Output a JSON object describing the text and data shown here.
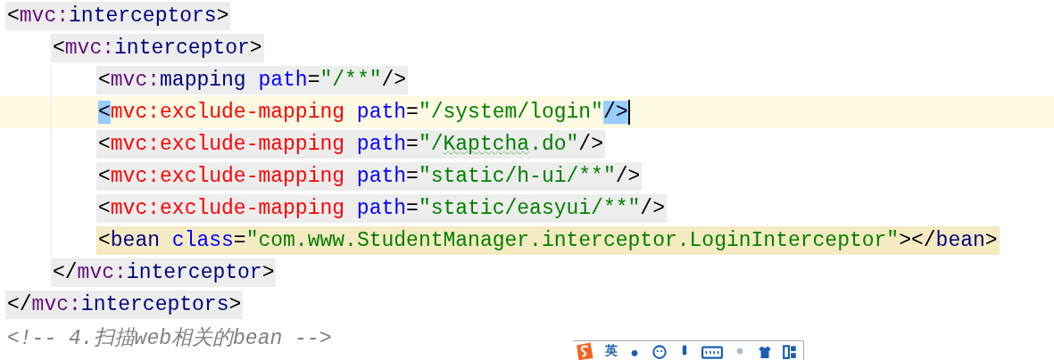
{
  "lines": [
    {
      "kind": "shaded",
      "tokens": [
        {
          "kind": "punct",
          "text": "<"
        },
        {
          "kind": "ns",
          "text": "mvc:"
        },
        {
          "kind": "tag",
          "text": "interceptors"
        },
        {
          "kind": "punct",
          "text": ">"
        }
      ],
      "children": [
        {
          "kind": "shaded",
          "tokens": [
            {
              "kind": "punct",
              "text": "<"
            },
            {
              "kind": "ns",
              "text": "mvc:"
            },
            {
              "kind": "tag",
              "text": "interceptor"
            },
            {
              "kind": "punct",
              "text": ">"
            }
          ],
          "children": [
            {
              "kind": "shaded",
              "tokens": [
                {
                  "kind": "punct",
                  "text": "<"
                },
                {
                  "kind": "ns",
                  "text": "mvc:"
                },
                {
                  "kind": "tag",
                  "text": "mapping"
                },
                {
                  "kind": "attr",
                  "text": "path"
                },
                {
                  "kind": "punct",
                  "text": "="
                },
                {
                  "kind": "value",
                  "text": "\"/**\""
                },
                {
                  "kind": "punct",
                  "text": "/>"
                }
              ]
            },
            {
              "kind": "plain",
              "current": true,
              "tokens": [
                {
                  "kind": "punct",
                  "text": "<",
                  "matched": true
                },
                {
                  "kind": "error_tag",
                  "text": "mvc:exclude-mapping"
                },
                {
                  "kind": "attr",
                  "text": "path"
                },
                {
                  "kind": "punct",
                  "text": "="
                },
                {
                  "kind": "value",
                  "text": "\"/system/login\""
                },
                {
                  "kind": "punct",
                  "text": "/>",
                  "matched": true
                }
              ]
            },
            {
              "kind": "shaded",
              "tokens": [
                {
                  "kind": "punct",
                  "text": "<"
                },
                {
                  "kind": "error_tag",
                  "text": "mvc:exclude-mapping"
                },
                {
                  "kind": "attr",
                  "text": "path"
                },
                {
                  "kind": "punct",
                  "text": "="
                },
                {
                  "kind": "value",
                  "text": "\"/"
                },
                {
                  "kind": "value",
                  "text": "Kaptcha",
                  "typo": true
                },
                {
                  "kind": "value",
                  "text": ".do\""
                },
                {
                  "kind": "punct",
                  "text": "/>"
                }
              ]
            },
            {
              "kind": "shaded",
              "tokens": [
                {
                  "kind": "punct",
                  "text": "<"
                },
                {
                  "kind": "error_tag",
                  "text": "mvc:exclude-mapping"
                },
                {
                  "kind": "attr",
                  "text": "path"
                },
                {
                  "kind": "punct",
                  "text": "="
                },
                {
                  "kind": "value",
                  "text": "\"static/h-ui/**\""
                },
                {
                  "kind": "punct",
                  "text": "/>"
                }
              ]
            },
            {
              "kind": "shaded",
              "tokens": [
                {
                  "kind": "punct",
                  "text": "<"
                },
                {
                  "kind": "error_tag",
                  "text": "mvc:exclude-mapping"
                },
                {
                  "kind": "attr",
                  "text": "path"
                },
                {
                  "kind": "punct",
                  "text": "="
                },
                {
                  "kind": "value",
                  "text": "\"static/easyui/**\""
                },
                {
                  "kind": "punct",
                  "text": "/>"
                }
              ]
            },
            {
              "kind": "matched",
              "tokens": [
                {
                  "kind": "punct",
                  "text": "<"
                },
                {
                  "kind": "tag",
                  "text": "bean"
                },
                {
                  "kind": "attr",
                  "text": "class"
                },
                {
                  "kind": "punct",
                  "text": "="
                },
                {
                  "kind": "value",
                  "text": "\"com.www.StudentManager.interceptor.LoginInterceptor\""
                },
                {
                  "kind": "punct",
                  "text": "></"
                },
                {
                  "kind": "tag",
                  "text": "bean"
                },
                {
                  "kind": "punct",
                  "text": ">"
                }
              ]
            }
          ],
          "end": {
            "kind": "shaded",
            "tokens": [
              {
                "kind": "punct",
                "text": "</"
              },
              {
                "kind": "ns",
                "text": "mvc:"
              },
              {
                "kind": "tag",
                "text": "interceptor"
              },
              {
                "kind": "punct",
                "text": ">"
              }
            ]
          }
        }
      ],
      "end": {
        "kind": "shaded",
        "tokens": [
          {
            "kind": "punct",
            "text": "</"
          },
          {
            "kind": "ns",
            "text": "mvc:"
          },
          {
            "kind": "tag",
            "text": "interceptors"
          },
          {
            "kind": "punct",
            "text": ">"
          }
        ]
      }
    },
    {
      "kind": "plain",
      "tokens": [
        {
          "kind": "comment",
          "text": "<!-- 4.扫描web相关的bean -->"
        }
      ]
    }
  ],
  "ime_toolbar": {
    "mode": "英"
  }
}
